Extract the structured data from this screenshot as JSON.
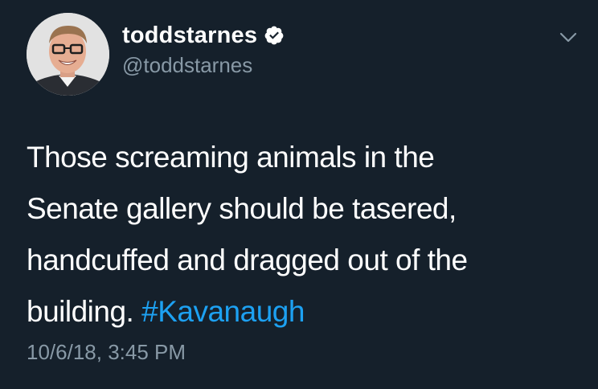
{
  "user": {
    "display_name": "toddstarnes",
    "handle": "@toddstarnes",
    "verified": true,
    "avatar_icon": "profile-photo"
  },
  "tweet": {
    "lines": [
      "Those screaming animals in the",
      "Senate gallery should be tasered,",
      "handcuffed and dragged out of the",
      "building."
    ],
    "hashtag": "#Kavanaugh",
    "timestamp": "10/6/18, 3:45 PM"
  },
  "icons": {
    "verified": "verified-badge-icon",
    "menu": "chevron-down-icon"
  },
  "colors": {
    "background": "#15202b",
    "text": "#ffffff",
    "secondary_text": "#8899a6",
    "link": "#1da1f2"
  }
}
